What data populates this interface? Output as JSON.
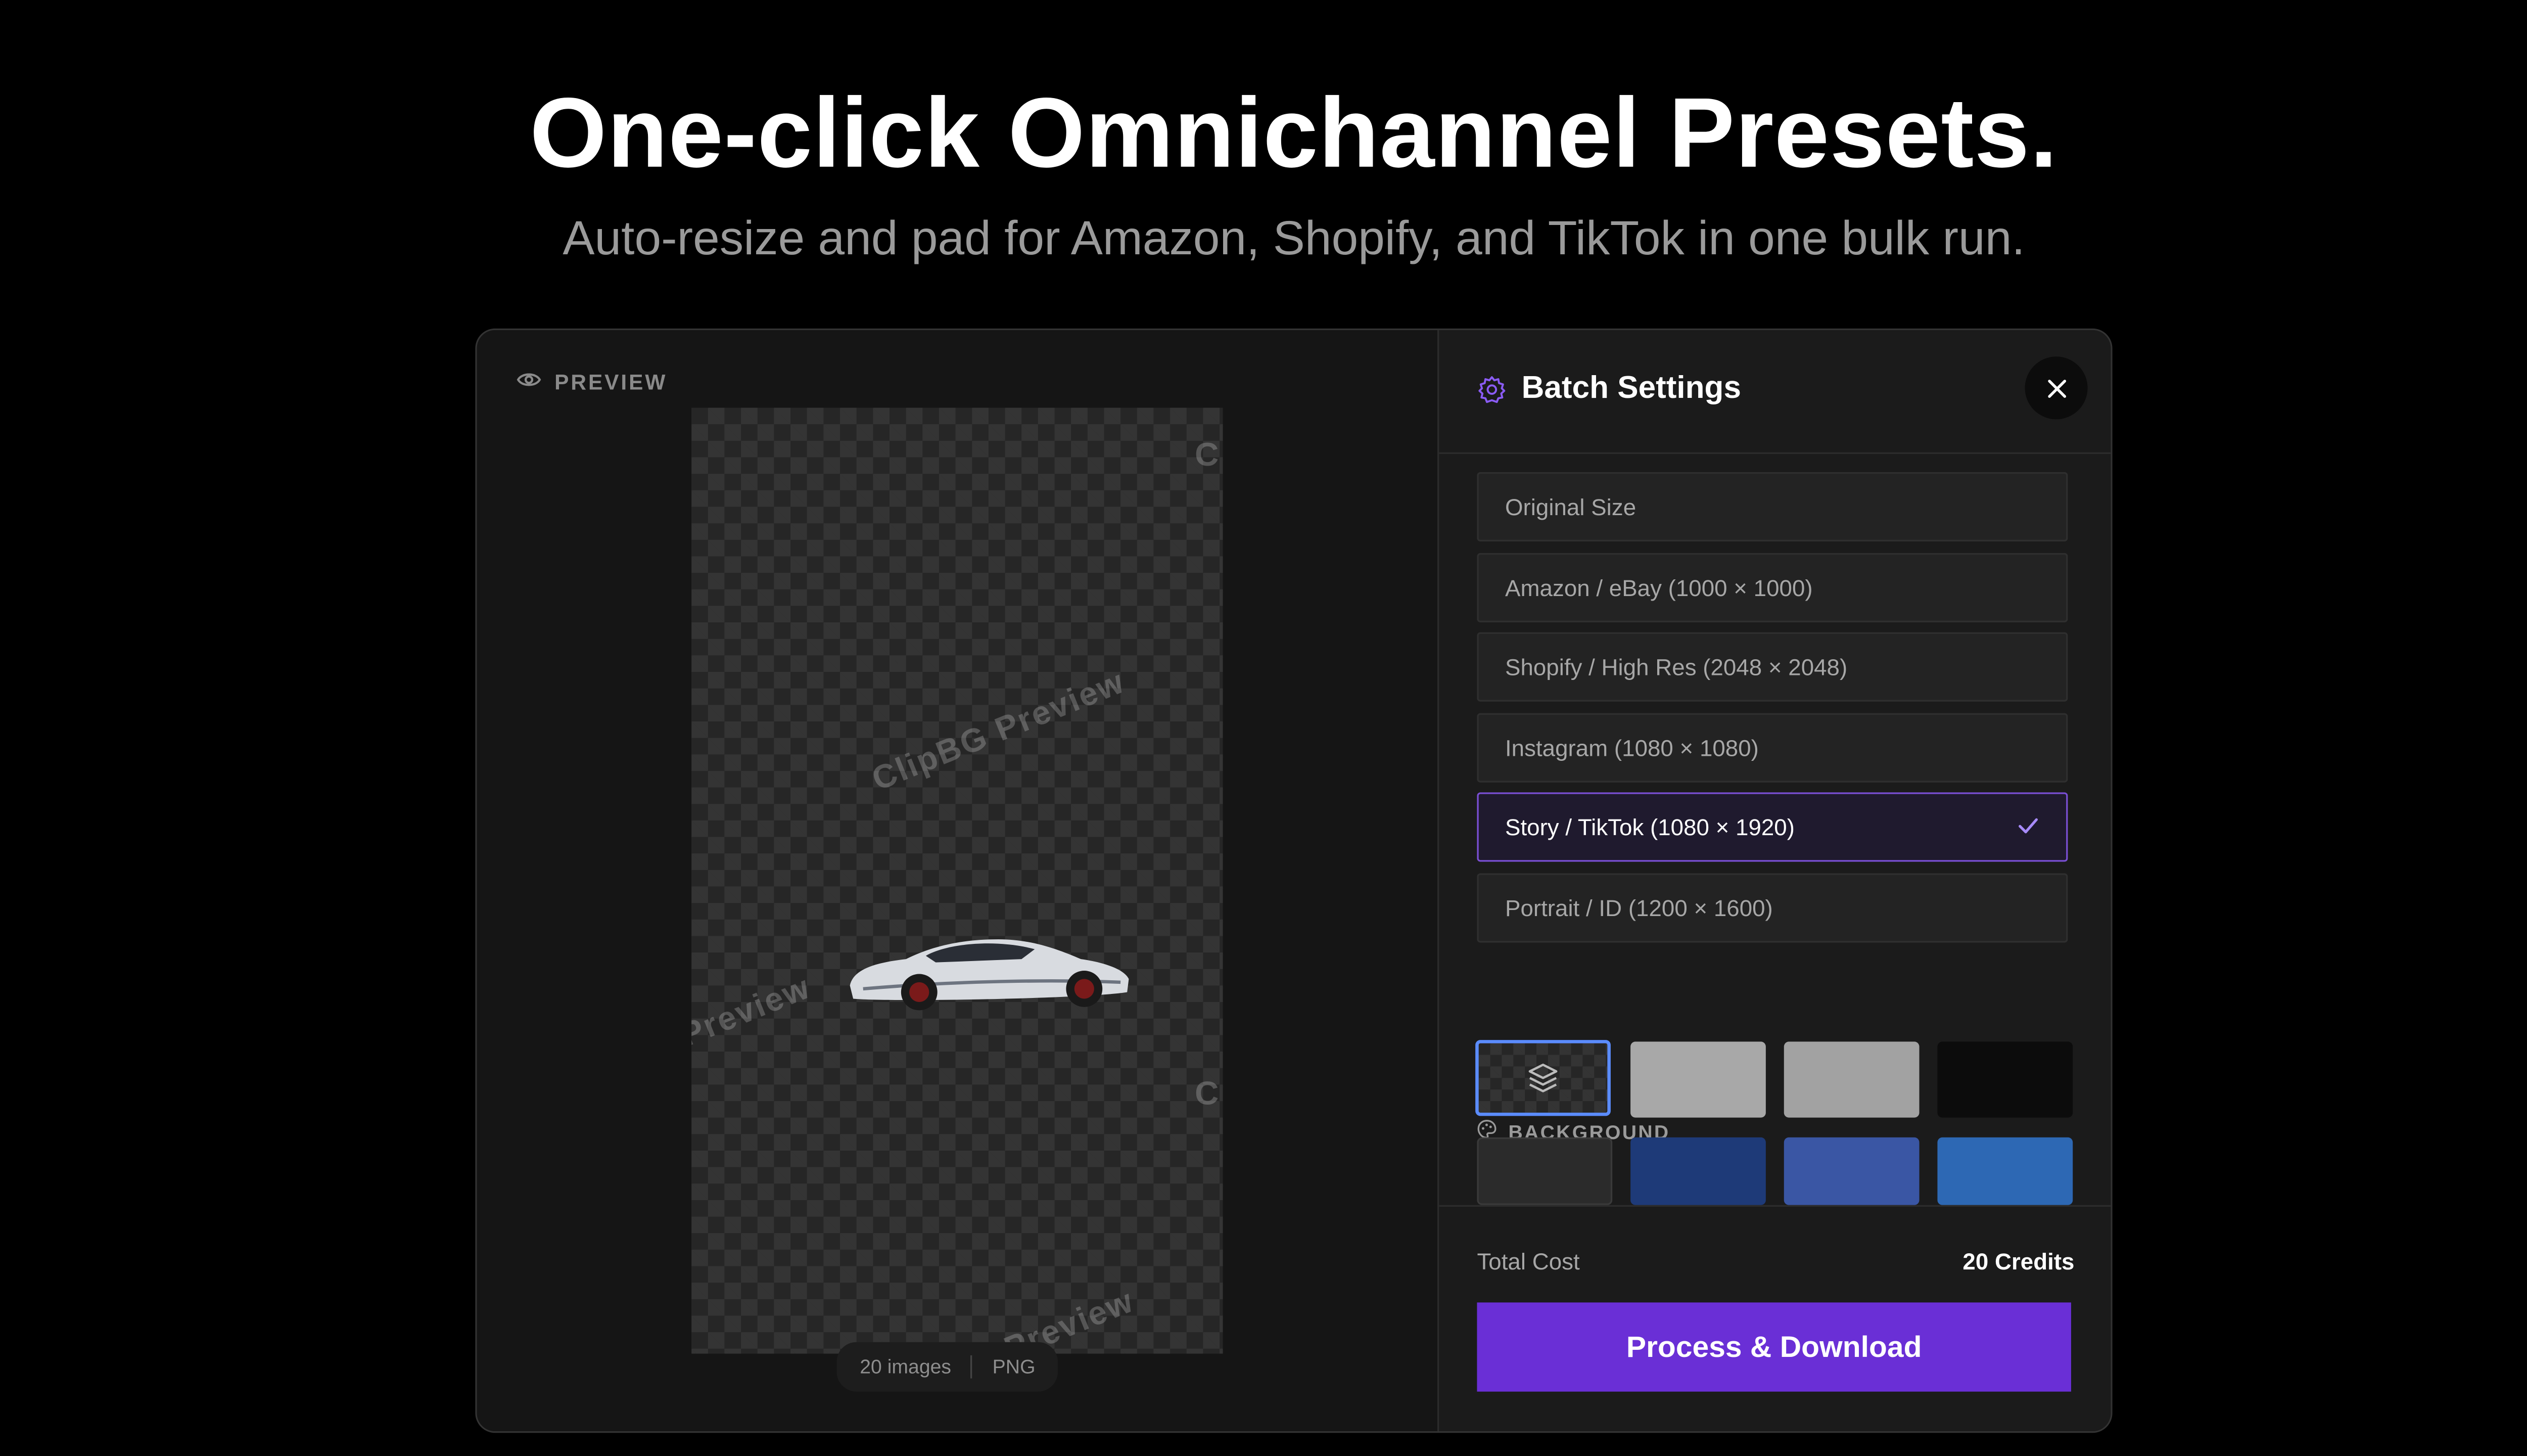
{
  "hero": {
    "headline": "One-click Omnichannel Presets.",
    "subline": "Auto-resize and pad for Amazon, Shopify, and TikTok in one bulk run."
  },
  "preview": {
    "label": "PREVIEW",
    "watermark_main": "ClipBG Preview",
    "watermark_left": "Preview",
    "watermark_bottom": "Preview",
    "watermark_edge": "C",
    "count": "20 images",
    "format": "PNG"
  },
  "panel": {
    "title": "Batch Settings",
    "presets": [
      {
        "label": "Original Size"
      },
      {
        "label": "Amazon / eBay (1000 × 1000)"
      },
      {
        "label": "Shopify / High Res (2048 × 2048)"
      },
      {
        "label": "Instagram (1080 × 1080)"
      },
      {
        "label": "Story / TikTok (1080 × 1920)"
      },
      {
        "label": "Portrait / ID (1200 × 1600)"
      }
    ],
    "selected_preset_index": 4,
    "background_label": "BACKGROUND",
    "swatches": [
      "transparent",
      "#a8a8a8",
      "#a2a2a2",
      "#0c0c0c",
      "#2b2b2b",
      "#1e3a78",
      "#3a56a4",
      "#2d68b4"
    ],
    "selected_swatch_index": 0,
    "total_cost_label": "Total Cost",
    "total_cost_value": "20 Credits",
    "cta_label": "Process & Download"
  },
  "colors": {
    "accent": "#6a2fd6",
    "selected_border": "#7a4fd4",
    "background": "#000000"
  }
}
